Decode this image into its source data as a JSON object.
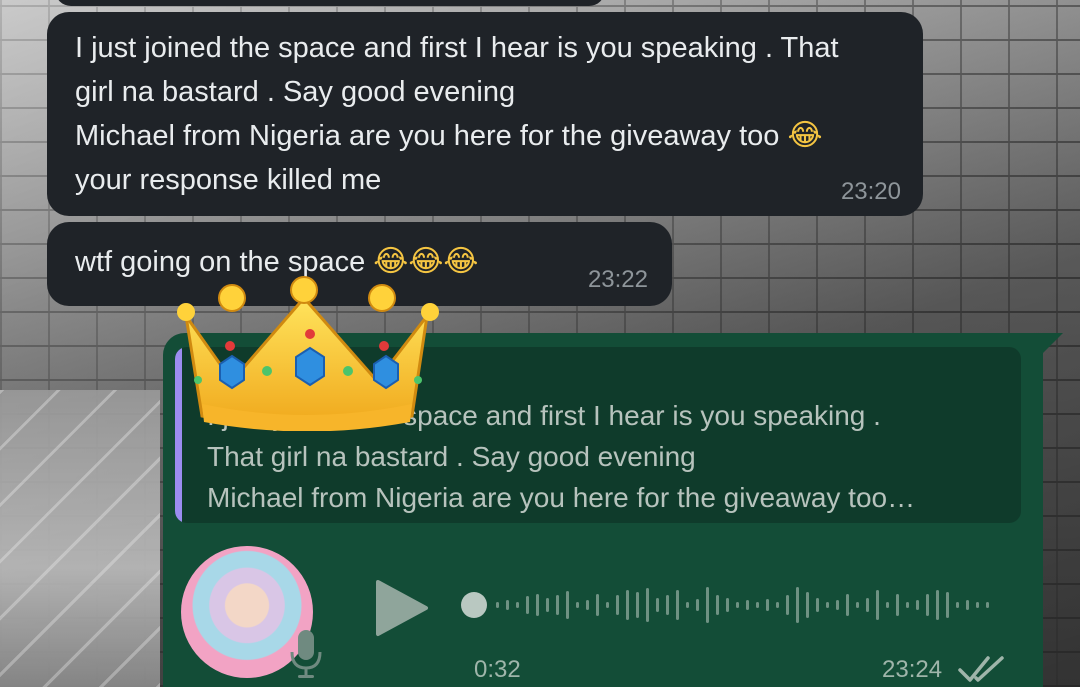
{
  "messages": {
    "incoming_1": {
      "text": "I just joined the space and first I hear is you speaking . That\ngirl na bastard . Say good evening\nMichael from Nigeria are you here for the giveaway too ",
      "text_end": "\nyour response killed me",
      "emoji": "😂",
      "time": "23:20"
    },
    "incoming_2": {
      "text": "wtf going on the space ",
      "emojis": "😂😂😂",
      "time": "23:22"
    },
    "outgoing": {
      "quote_text": "I just joined the space and first I hear is you speaking .\nThat girl na bastard . Say good evening\nMichael from Nigeria are you here for the giveaway too…",
      "voice_duration": "0:32",
      "time": "23:24",
      "status": "read"
    }
  },
  "colors": {
    "incoming_bubble": "#1f2328",
    "outgoing_bubble": "#134d37",
    "quote_bar": "#9b8df0",
    "text": "#e9ecee"
  },
  "icons": [
    "crown-icon",
    "play-icon",
    "mic-icon",
    "double-check-icon",
    "tears-of-joy-emoji"
  ]
}
